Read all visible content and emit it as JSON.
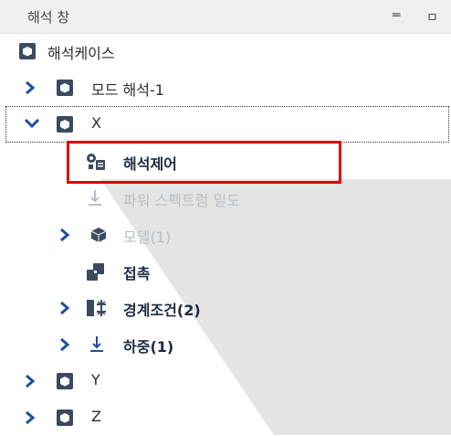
{
  "header": {
    "title": "해석 창",
    "minimize_glyph": "═",
    "pin_glyph": "ㅁ"
  },
  "tree": {
    "root_label": "해석케이스",
    "modal_label": "모드 해석-1",
    "x_case": {
      "label": "X",
      "control_label": "해석제어",
      "psd_label": "파워 스펙트럼 밀도",
      "model_label": "모델(1)",
      "contact_label": "접촉",
      "boundary_label": "경계조건(2)",
      "load_label": "하중(1)"
    },
    "y_label": "Y",
    "z_label": "Z"
  },
  "colors": {
    "accent_red": "#e00000",
    "icon_dark": "#3b4a5f",
    "chevron_blue": "#1f4e9c",
    "disabled_text": "#b9bec4"
  }
}
